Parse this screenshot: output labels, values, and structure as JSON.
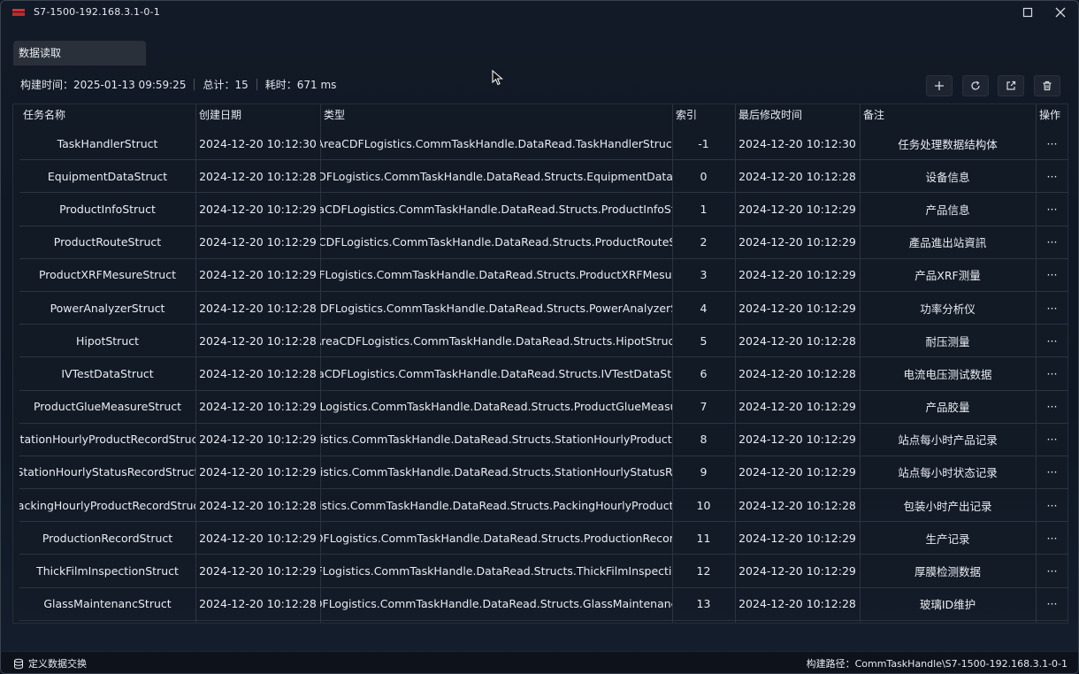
{
  "window": {
    "title": "S7-1500-192.168.3.1-0-1"
  },
  "tab": {
    "label": "数据读取"
  },
  "info": {
    "build_time": "构建时间：2025-01-13 09:59:25",
    "total": "总计：15",
    "elapsed": "耗时：671 ms"
  },
  "table": {
    "headers": [
      "任务名称",
      "创建日期",
      "类型",
      "索引",
      "最后修改时间",
      "备注",
      "操作"
    ],
    "rows": [
      {
        "name": "TaskHandlerStruct",
        "created": "2024-12-20 10:12:30",
        "type": "AreaCDFLogistics.CommTaskHandle.DataRead.TaskHandlerStruct",
        "index": "-1",
        "modified": "2024-12-20 10:12:30",
        "note": "任务处理数据结构体",
        "op": "···"
      },
      {
        "name": "EquipmentDataStruct",
        "created": "2024-12-20 10:12:28",
        "type": "eaCDFLogistics.CommTaskHandle.DataRead.Structs.EquipmentDataStru",
        "index": "0",
        "modified": "2024-12-20 10:12:28",
        "note": "设备信息",
        "op": "···"
      },
      {
        "name": "ProductInfoStruct",
        "created": "2024-12-20 10:12:29",
        "type": "AreaCDFLogistics.CommTaskHandle.DataRead.Structs.ProductInfoStruc",
        "index": "1",
        "modified": "2024-12-20 10:12:29",
        "note": "产品信息",
        "op": "···"
      },
      {
        "name": "ProductRouteStruct",
        "created": "2024-12-20 10:12:29",
        "type": "reaCDFLogistics.CommTaskHandle.DataRead.Structs.ProductRouteStru",
        "index": "2",
        "modified": "2024-12-20 10:12:29",
        "note": "產品進出站資訊",
        "op": "···"
      },
      {
        "name": "ProductXRFMesureStruct",
        "created": "2024-12-20 10:12:29",
        "type": "CDFLogistics.CommTaskHandle.DataRead.Structs.ProductXRFMesureS",
        "index": "3",
        "modified": "2024-12-20 10:12:29",
        "note": "产品XRF测量",
        "op": "···"
      },
      {
        "name": "PowerAnalyzerStruct",
        "created": "2024-12-20 10:12:28",
        "type": "eaCDFLogistics.CommTaskHandle.DataRead.Structs.PowerAnalyzerStru",
        "index": "4",
        "modified": "2024-12-20 10:12:29",
        "note": "功率分析仪",
        "op": "···"
      },
      {
        "name": "HipotStruct",
        "created": "2024-12-20 10:12:28",
        "type": "AreaCDFLogistics.CommTaskHandle.DataRead.Structs.HipotStruct",
        "index": "5",
        "modified": "2024-12-20 10:12:28",
        "note": "耐压测量",
        "op": "···"
      },
      {
        "name": "IVTestDataStruct",
        "created": "2024-12-20 10:12:28",
        "type": "AreaCDFLogistics.CommTaskHandle.DataRead.Structs.IVTestDataStruct",
        "index": "6",
        "modified": "2024-12-20 10:12:28",
        "note": "电流电压测试数据",
        "op": "···"
      },
      {
        "name": "ProductGlueMeasureStruct",
        "created": "2024-12-20 10:12:29",
        "type": "CDFLogistics.CommTaskHandle.DataRead.Structs.ProductGlueMeasureS",
        "index": "7",
        "modified": "2024-12-20 10:12:29",
        "note": "产品胶量",
        "op": "···"
      },
      {
        "name": "StationHourlyProductRecordStruct",
        "created": "2024-12-20 10:12:29",
        "type": "Logistics.CommTaskHandle.DataRead.Structs.StationHourlyProductRec",
        "index": "8",
        "modified": "2024-12-20 10:12:29",
        "note": "站点每小时产品记录",
        "op": "···"
      },
      {
        "name": "StationHourlyStatusRecordStruct",
        "created": "2024-12-20 10:12:29",
        "type": "Logistics.CommTaskHandle.DataRead.Structs.StationHourlyStatusReco",
        "index": "9",
        "modified": "2024-12-20 10:12:29",
        "note": "站点每小时状态记录",
        "op": "···"
      },
      {
        "name": "PackingHourlyProductRecordStruct",
        "created": "2024-12-20 10:12:28",
        "type": "Logistics.CommTaskHandle.DataRead.Structs.PackingHourlyProductRec",
        "index": "10",
        "modified": "2024-12-20 10:12:28",
        "note": "包装小时产出记录",
        "op": "···"
      },
      {
        "name": "ProductionRecordStruct",
        "created": "2024-12-20 10:12:29",
        "type": "aCDFLogistics.CommTaskHandle.DataRead.Structs.ProductionRecordSt",
        "index": "11",
        "modified": "2024-12-20 10:12:29",
        "note": "生产记录",
        "op": "···"
      },
      {
        "name": "ThickFilmInspectionStruct",
        "created": "2024-12-20 10:12:29",
        "type": "CDFLogistics.CommTaskHandle.DataRead.Structs.ThickFilmInspectionS",
        "index": "12",
        "modified": "2024-12-20 10:12:29",
        "note": "厚膜检测数据",
        "op": "···"
      },
      {
        "name": "GlassMaintenancStruct",
        "created": "2024-12-20 10:12:28",
        "type": "aCDFLogistics.CommTaskHandle.DataRead.Structs.GlassMaintenancStr",
        "index": "13",
        "modified": "2024-12-20 10:12:28",
        "note": "玻璃ID维护",
        "op": "···"
      }
    ]
  },
  "status": {
    "left_label": "定义数据交换",
    "right_label": "构建路径：CommTaskHandle\\S7-1500-192.168.3.1-0-1"
  },
  "icons": {
    "logo": "app-logo",
    "maximize": "maximize-icon",
    "close": "close-icon",
    "add": "plus-icon",
    "refresh": "refresh-icon",
    "export": "export-icon",
    "delete": "trash-icon",
    "status": "database-icon",
    "cursor": "mouse-cursor-icon"
  }
}
